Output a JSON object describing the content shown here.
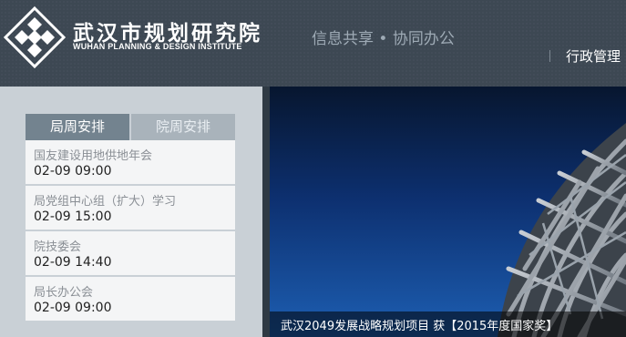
{
  "header": {
    "org_name_cn": "武汉市规划研究院",
    "org_name_en": "WUHAN PLANNING & DESIGN INSTITUTE",
    "slogan": "信息共享 • 协同办公",
    "nav_items": [
      "行政管理"
    ]
  },
  "sidebar": {
    "tabs": [
      {
        "label": "局周安排",
        "active": true
      },
      {
        "label": "院周安排",
        "active": false
      }
    ],
    "schedule": [
      {
        "title": "国友建设用地供地年会",
        "time": "02-09  09:00"
      },
      {
        "title": "局党组中心组（扩大）学习",
        "time": "02-09  15:00"
      },
      {
        "title": "院技委会",
        "time": "02-09  14:40"
      },
      {
        "title": "局长办公会",
        "time": "02-09  09:00"
      }
    ]
  },
  "banner": {
    "caption": "武汉2049发展战略规划项目 获【2015年度国家奖】"
  },
  "colors": {
    "header_bg": "#3d4853",
    "panel_bg": "#c9d0d6",
    "tab_active": "#73838f",
    "tab_inactive": "#a9b3bb",
    "banner_sky": "#0d3070"
  },
  "icons": [
    "logo-mark"
  ]
}
